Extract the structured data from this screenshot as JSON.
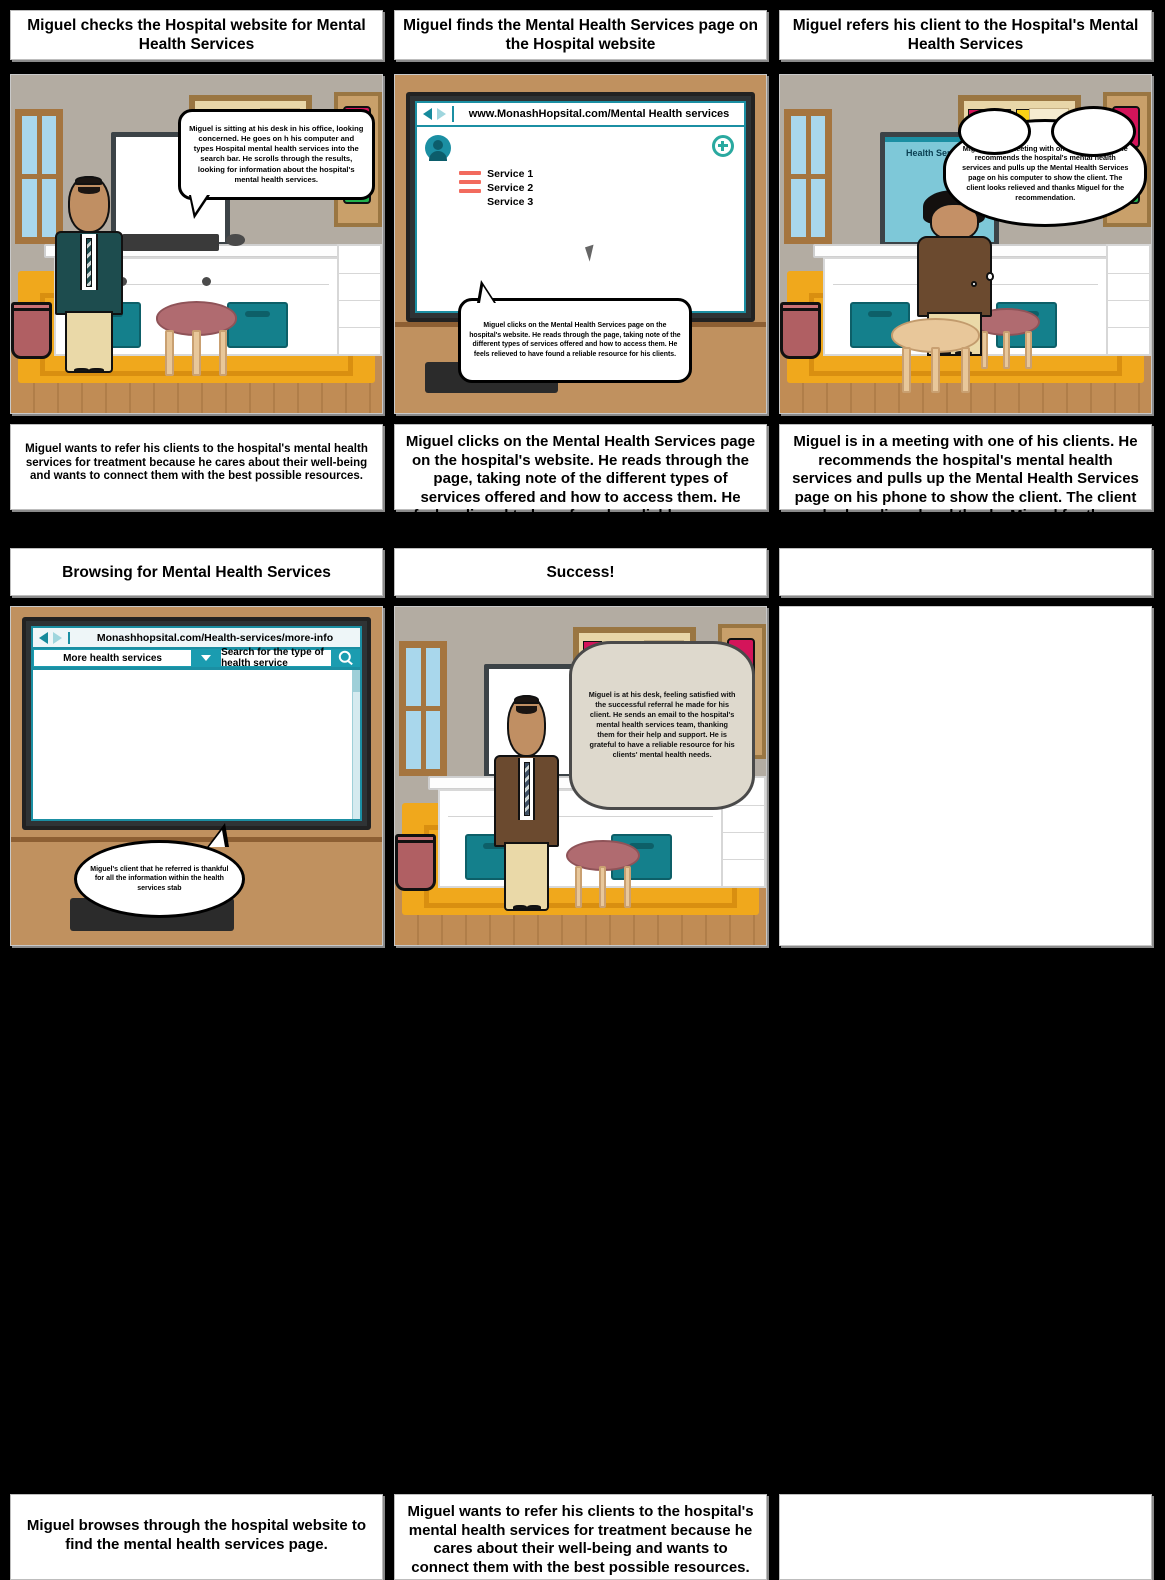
{
  "storyboard": {
    "panels": [
      {
        "id": "panel-1",
        "title": "Miguel checks the Hospital website for Mental Health Services",
        "bubble": "Miguel is sitting at his desk in his office, looking concerned. He goes on h his computer and types Hospital mental health services into the search bar. He scrolls through the results, looking for information about the hospital's mental health services.",
        "caption": "Miguel wants to refer his clients to the hospital's mental health services for treatment because he cares about their well-being and wants to connect them with the best possible resources."
      },
      {
        "id": "panel-2",
        "title": "Miguel finds the Mental Health Services page on the Hospital website",
        "bubble": "Miguel clicks on the Mental Health Services page on the hospital's website. He reads through the page, taking note of the different types of services offered and how to  access them. He feels relieved to have found a reliable resource for his clients.",
        "caption": "Miguel clicks on the Mental Health Services page on the hospital's website. He reads through the page, taking note of the different types of services offered and how to access them. He feels relieved to have found a reliable resource for his clients.",
        "browser": {
          "url": "www.MonashHopsital.com/Mental Health services",
          "back_icon": "back-arrow-icon",
          "forward_icon": "forward-arrow-icon",
          "avatar_icon": "user-avatar-icon",
          "add_icon": "plus-circle-icon",
          "menu_icon": "hamburger-menu-icon",
          "services": [
            "Service 1",
            "Service 2",
            "Service 3"
          ]
        }
      },
      {
        "id": "panel-3",
        "title": "Miguel refers his client to the Hospital's Mental Health Services",
        "bubble": "Miguel is in a meeting with one  of his clients. He recommends the hospital's mental health services and pulls up the Mental Health Services page on his computer to show the client. The client looks relieved and thanks Miguel for the recommendation.",
        "caption": "Miguel is in a meeting with one of his clients. He recommends the hospital's mental health services and pulls up the Mental Health Services page on his phone to show the client. The client looks relieved and thanks Miguel for the recommendation.",
        "monitor_text": "Health Services"
      },
      {
        "id": "panel-4",
        "title": "Browsing for Mental Health Services",
        "bubble": "Miguel's client that he referred is thankful for all the information within the health services stab",
        "caption": "Miguel browses through the hospital website to find the mental health services page.",
        "browser": {
          "url": "Monashhopsital.com/Health-services/more-info",
          "back_icon": "back-arrow-icon",
          "forward_icon": "forward-arrow-icon",
          "dropdown_value": "More health services",
          "dropdown_icon": "chevron-down-icon",
          "search_placeholder": "Search for the type of health service",
          "search_icon": "search-icon"
        }
      },
      {
        "id": "panel-5",
        "title": "Success!",
        "bubble": "Miguel is at his desk, feeling satisfied with the successful referral he made for his client. He sends an email to the hospital's mental health services team, thanking them for their help and support. He is grateful to have a reliable resource for his clients' mental health needs.",
        "caption": "Miguel wants to refer his clients to the hospital's mental health services for treatment because he cares about their well-being and wants to connect them with the best possible resources."
      },
      {
        "id": "panel-6",
        "title": "",
        "bubble": "",
        "caption": ""
      }
    ]
  },
  "colors": {
    "background": "#000000",
    "panel_background": "#ffffff",
    "panel_border": "#bdbdbd",
    "wall": "#b3aca2",
    "rug": "#f0a81c",
    "teal_bin": "#14808c",
    "browser_accent": "#1b8fa3",
    "stool": "#b06b70"
  }
}
